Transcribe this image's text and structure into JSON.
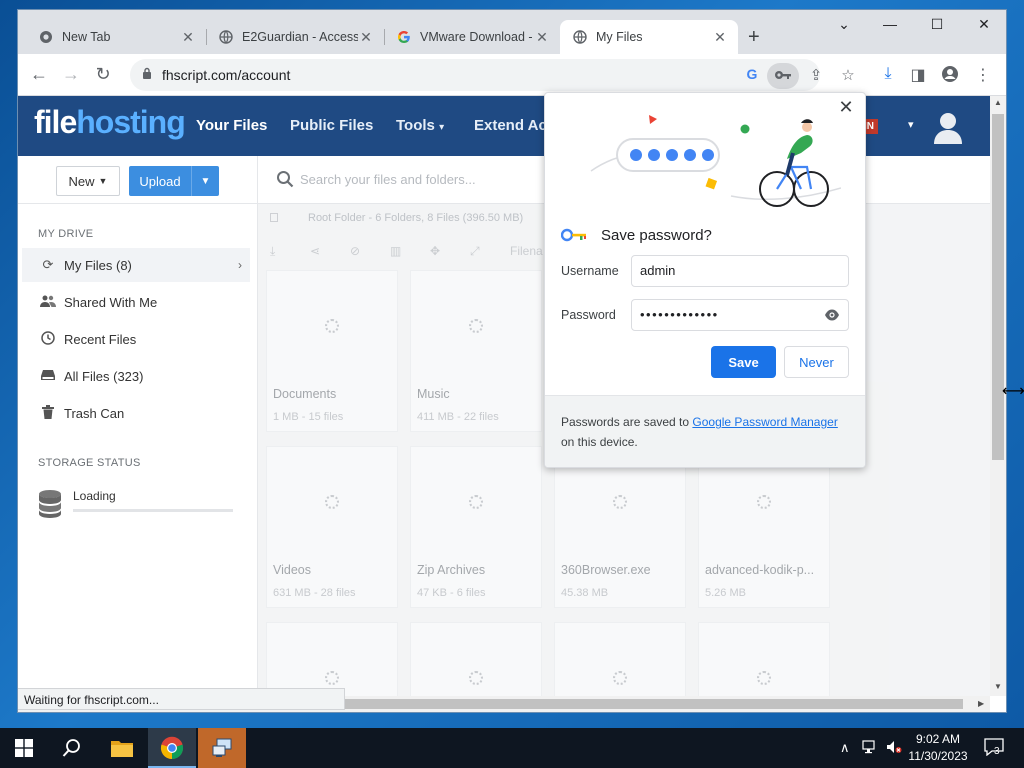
{
  "browser": {
    "tabs": [
      {
        "title": "New Tab",
        "icon": "chrome-icon",
        "active": false
      },
      {
        "title": "E2Guardian - Access D",
        "icon": "globe-icon",
        "active": false
      },
      {
        "title": "VMware Download - ",
        "icon": "google-icon",
        "active": false
      },
      {
        "title": "My Files",
        "icon": "globe-icon",
        "active": true
      }
    ],
    "url": "fhscript.com/account",
    "status_text": "Waiting for fhscript.com..."
  },
  "site": {
    "logo_part1": "file",
    "logo_part2": "hosting",
    "nav": {
      "your_files": "Your Files",
      "public_files": "Public Files",
      "tools": "Tools",
      "extend": "Extend Acc"
    },
    "login_badge": "IN",
    "new_button": "New",
    "upload_button": "Upload",
    "search_placeholder": "Search your files and folders...",
    "sidebar": {
      "my_drive_heading": "MY DRIVE",
      "items": [
        {
          "label": "My Files (8)",
          "icon": "sync-icon"
        },
        {
          "label": "Shared With Me",
          "icon": "users-icon"
        },
        {
          "label": "Recent Files",
          "icon": "clock-icon"
        },
        {
          "label": "All Files (323)",
          "icon": "drive-icon"
        },
        {
          "label": "Trash Can",
          "icon": "trash-icon"
        }
      ],
      "storage_heading": "STORAGE STATUS",
      "storage_label": "Loading"
    },
    "breadcrumb": "Root Folder - 6 Folders, 8 Files (396.50 MB)",
    "filename_column": "Filena",
    "cards": [
      {
        "title": "Documents",
        "sub": "1 MB - 15 files"
      },
      {
        "title": "Music",
        "sub": "411 MB - 22 files"
      },
      {
        "title": "Videos",
        "sub": "631 MB - 28 files"
      },
      {
        "title": "Zip Archives",
        "sub": "47 KB - 6 files"
      },
      {
        "title": "360Browser.exe",
        "sub": "45.38 MB"
      },
      {
        "title": "advanced-kodik-p...",
        "sub": "5.26 MB"
      }
    ]
  },
  "password_popup": {
    "title": "Save password?",
    "username_label": "Username",
    "username_value": "admin",
    "password_label": "Password",
    "password_value": "•••••••••••••",
    "save_button": "Save",
    "never_button": "Never",
    "footer_text_1": "Passwords are saved to ",
    "footer_link": "Google Password Manager",
    "footer_text_2": " on this device."
  },
  "taskbar": {
    "time": "9:02 AM",
    "date": "11/30/2023",
    "notification_count": "3"
  },
  "colors": {
    "site_header": "#1f4a83",
    "upload_blue": "#3c8ee0",
    "chrome_blue": "#1a73e8",
    "taskbar": "#0e1621"
  }
}
